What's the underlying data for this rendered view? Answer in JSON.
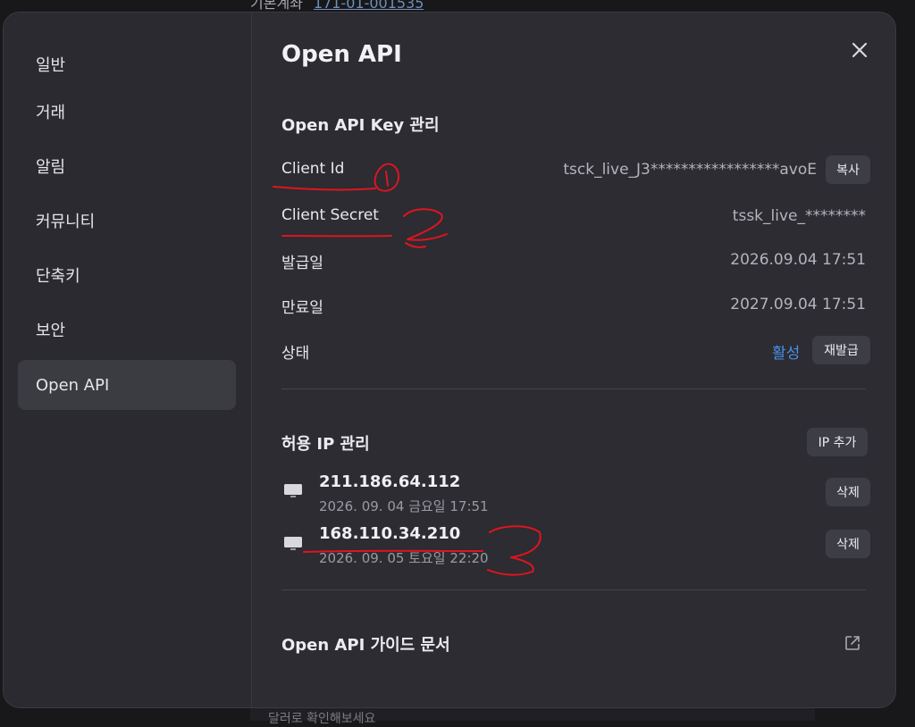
{
  "background": {
    "top_label": "기본계좌",
    "top_account": "171-01-001535",
    "bottom_text": "달러로 확인해보세요"
  },
  "sidebar": {
    "items": [
      {
        "label": "일반"
      },
      {
        "label": "거래"
      },
      {
        "label": "알림"
      },
      {
        "label": "커뮤니티"
      },
      {
        "label": "단축키"
      },
      {
        "label": "보안"
      },
      {
        "label": "Open API",
        "active": true
      }
    ]
  },
  "main": {
    "title": "Open API",
    "key_section": {
      "title": "Open API Key 관리",
      "client_id_label": "Client Id",
      "client_id_value": "tsck_live_J3*****************avoE",
      "copy_button": "복사",
      "client_secret_label": "Client Secret",
      "client_secret_value": "tssk_live_********",
      "issued_label": "발급일",
      "issued_value": "2026.09.04 17:51",
      "expiry_label": "만료일",
      "expiry_value": "2027.09.04 17:51",
      "status_label": "상태",
      "status_value": "활성",
      "reissue_button": "재발급"
    },
    "ip_section": {
      "title": "허용 IP 관리",
      "add_button": "IP 추가",
      "items": [
        {
          "ip": "211.186.64.112",
          "date": "2026. 09. 04 금요일 17:51",
          "delete": "삭제"
        },
        {
          "ip": "168.110.34.210",
          "date": "2026. 09. 05 토요일 22:20",
          "delete": "삭제"
        }
      ]
    },
    "guide_label": "Open API 가이드 문서"
  },
  "annotations": [
    "1",
    "2",
    "3"
  ],
  "colors": {
    "accent": "#4a90e8",
    "annotation": "#e0141e",
    "modal_bg": "#2c2c32"
  }
}
